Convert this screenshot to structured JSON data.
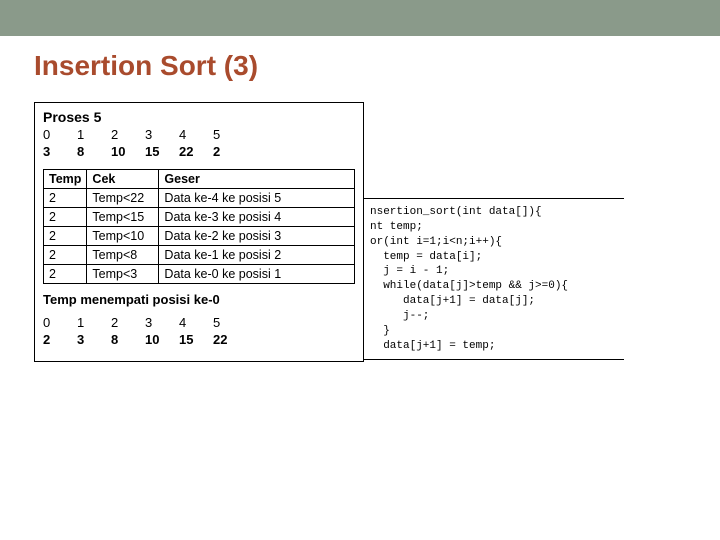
{
  "title": "Insertion Sort (3)",
  "proses_label": "Proses 5",
  "indices_before": [
    "0",
    "1",
    "2",
    "3",
    "4",
    "5"
  ],
  "values_before": [
    "3",
    "8",
    "10",
    "15",
    "22",
    "2"
  ],
  "trace": {
    "headers": [
      "Temp",
      "Cek",
      "Geser"
    ],
    "rows": [
      {
        "temp": "2",
        "cek": "Temp<22",
        "geser": "Data ke-4 ke posisi 5"
      },
      {
        "temp": "2",
        "cek": "Temp<15",
        "geser": "Data ke-3 ke posisi 4"
      },
      {
        "temp": "2",
        "cek": "Temp<10",
        "geser": "Data ke-2 ke posisi 3"
      },
      {
        "temp": "2",
        "cek": "Temp<8",
        "geser": "Data ke-1 ke posisi 2"
      },
      {
        "temp": "2",
        "cek": "Temp<3",
        "geser": "Data ke-0 ke posisi 1"
      }
    ]
  },
  "result_line": "Temp menempati posisi ke-0",
  "indices_after": [
    "0",
    "1",
    "2",
    "3",
    "4",
    "5"
  ],
  "values_after": [
    "2",
    "3",
    "8",
    "10",
    "15",
    "22"
  ],
  "code": "nsertion_sort(int data[]){\nnt temp;\nor(int i=1;i<n;i++){\n  temp = data[i];\n  j = i - 1;\n  while(data[j]>temp && j>=0){\n     data[j+1] = data[j];\n     j--;\n  }\n  data[j+1] = temp;"
}
